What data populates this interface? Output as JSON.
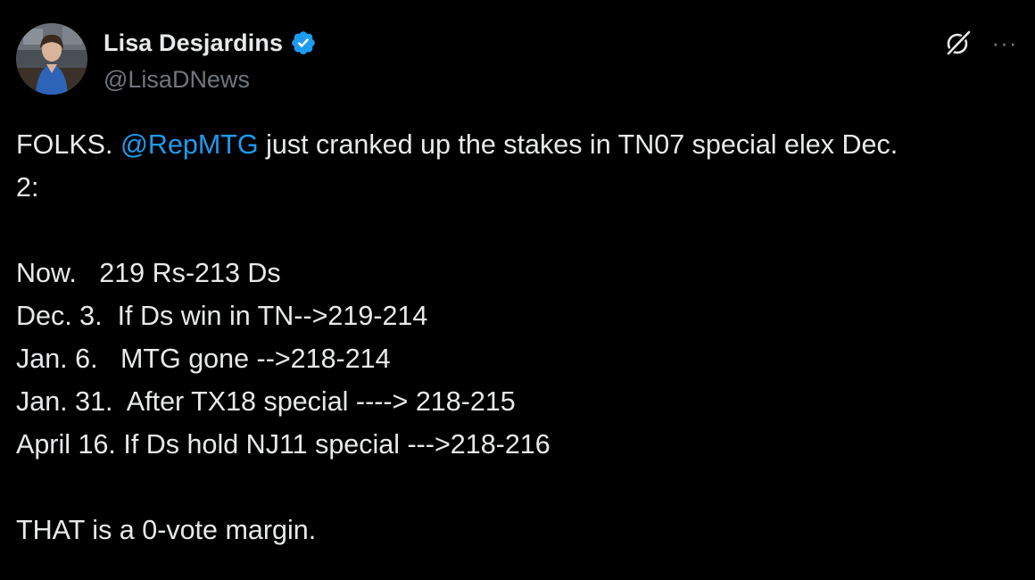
{
  "author": {
    "display_name": "Lisa Desjardins",
    "handle": "@LisaDNews",
    "verified": true,
    "verified_color": "#1d9bf0"
  },
  "icons": {
    "grok": "grok-icon",
    "more": "more-horizontal-icon",
    "more_glyph": "···"
  },
  "tweet": {
    "line1_pre": "FOLKS. ",
    "mention": "@RepMTG",
    "line1_post": " just cranked up the stakes in TN07 special elex Dec.",
    "line2": "2:",
    "line3": "Now.   219 Rs-213 Ds",
    "line4": "Dec. 3.  If Ds win in TN-->219-214",
    "line5": "Jan. 6.   MTG gone -->218-214",
    "line6": "Jan. 31.  After TX18 special ----> 218-215",
    "line7": "April 16. If Ds hold NJ11 special --->218-216",
    "line8": "THAT is a 0-vote margin."
  },
  "colors": {
    "background": "#000000",
    "text": "#e7e9ea",
    "secondary": "#71767b",
    "link": "#1d9bf0"
  }
}
